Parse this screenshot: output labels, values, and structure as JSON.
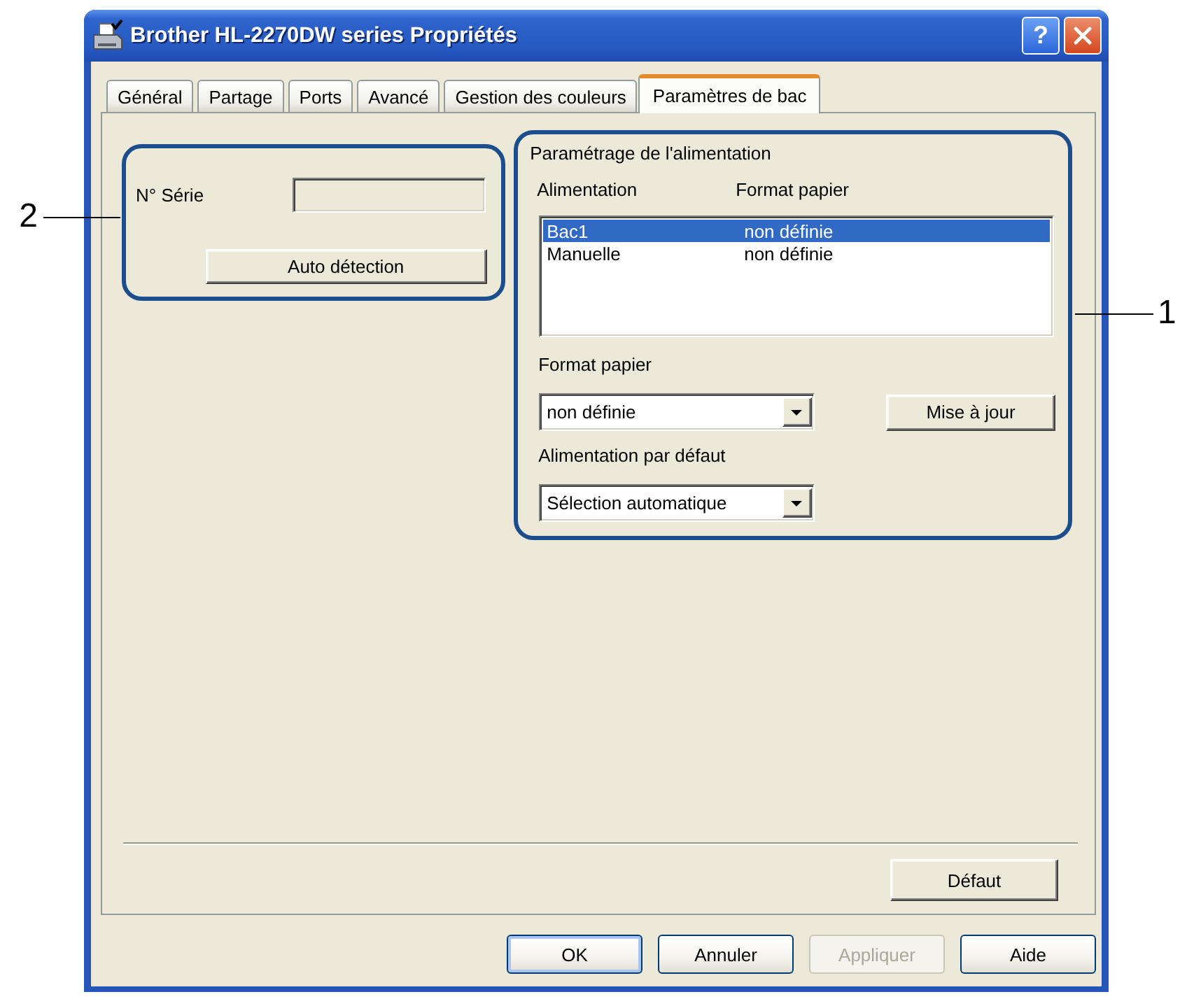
{
  "window": {
    "title": "Brother HL-2270DW series Propriétés",
    "help_button": "?"
  },
  "tabs": [
    {
      "label": "Général",
      "selected": false
    },
    {
      "label": "Partage",
      "selected": false
    },
    {
      "label": "Ports",
      "selected": false
    },
    {
      "label": "Avancé",
      "selected": false
    },
    {
      "label": "Gestion des couleurs",
      "selected": false
    },
    {
      "label": "Paramètres de bac",
      "selected": true
    }
  ],
  "serial_group": {
    "callout": "2",
    "serial_label": "N° Série",
    "serial_field": {
      "disabled": true
    },
    "auto_detect_button": "Auto détection"
  },
  "source_group": {
    "callout": "1",
    "title": "Paramétrage de l'alimentation",
    "columns": [
      "Alimentation",
      "Format papier"
    ],
    "rows": [
      {
        "cells": [
          "Bac1",
          "non définie"
        ],
        "selected": true
      },
      {
        "cells": [
          "Manuelle",
          "non définie"
        ],
        "selected": false
      }
    ],
    "paper_size": {
      "label": "Format papier",
      "value": "non définie"
    },
    "update_button": "Mise à jour",
    "default_source": {
      "label": "Alimentation par défaut",
      "value": "Sélection automatique"
    }
  },
  "default_button": "Défaut",
  "dialog_buttons": [
    {
      "label": "OK",
      "default": true,
      "disabled": false
    },
    {
      "label": "Annuler",
      "default": false,
      "disabled": false
    },
    {
      "label": "Appliquer",
      "default": false,
      "disabled": true
    },
    {
      "label": "Aide",
      "default": false,
      "disabled": false
    }
  ]
}
